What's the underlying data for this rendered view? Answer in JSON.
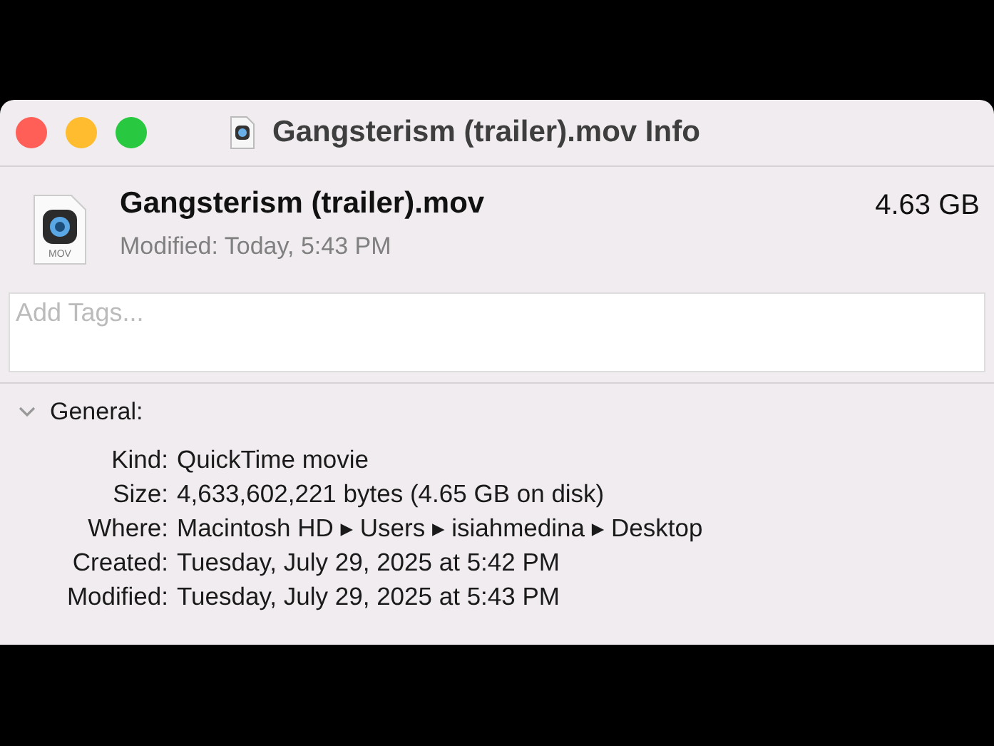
{
  "window": {
    "title": "Gangsterism (trailer).mov Info"
  },
  "file": {
    "name": "Gangsterism (trailer).mov",
    "size": "4.63 GB",
    "modified": "Modified: Today, 5:43 PM",
    "icon_label": "MOV"
  },
  "tags": {
    "placeholder": "Add Tags..."
  },
  "section": {
    "title": "General:",
    "expanded": true,
    "rows": [
      {
        "label": "Kind:",
        "value": "QuickTime movie"
      },
      {
        "label": "Size:",
        "value": "4,633,602,221 bytes (4.65 GB on disk)"
      },
      {
        "label": "Where:",
        "value": "Macintosh HD ▸ Users ▸ isiahmedina ▸ Desktop"
      },
      {
        "label": "Created:",
        "value": "Tuesday, July 29, 2025 at 5:42 PM"
      },
      {
        "label": "Modified:",
        "value": "Tuesday, July 29, 2025 at 5:43 PM"
      }
    ]
  }
}
